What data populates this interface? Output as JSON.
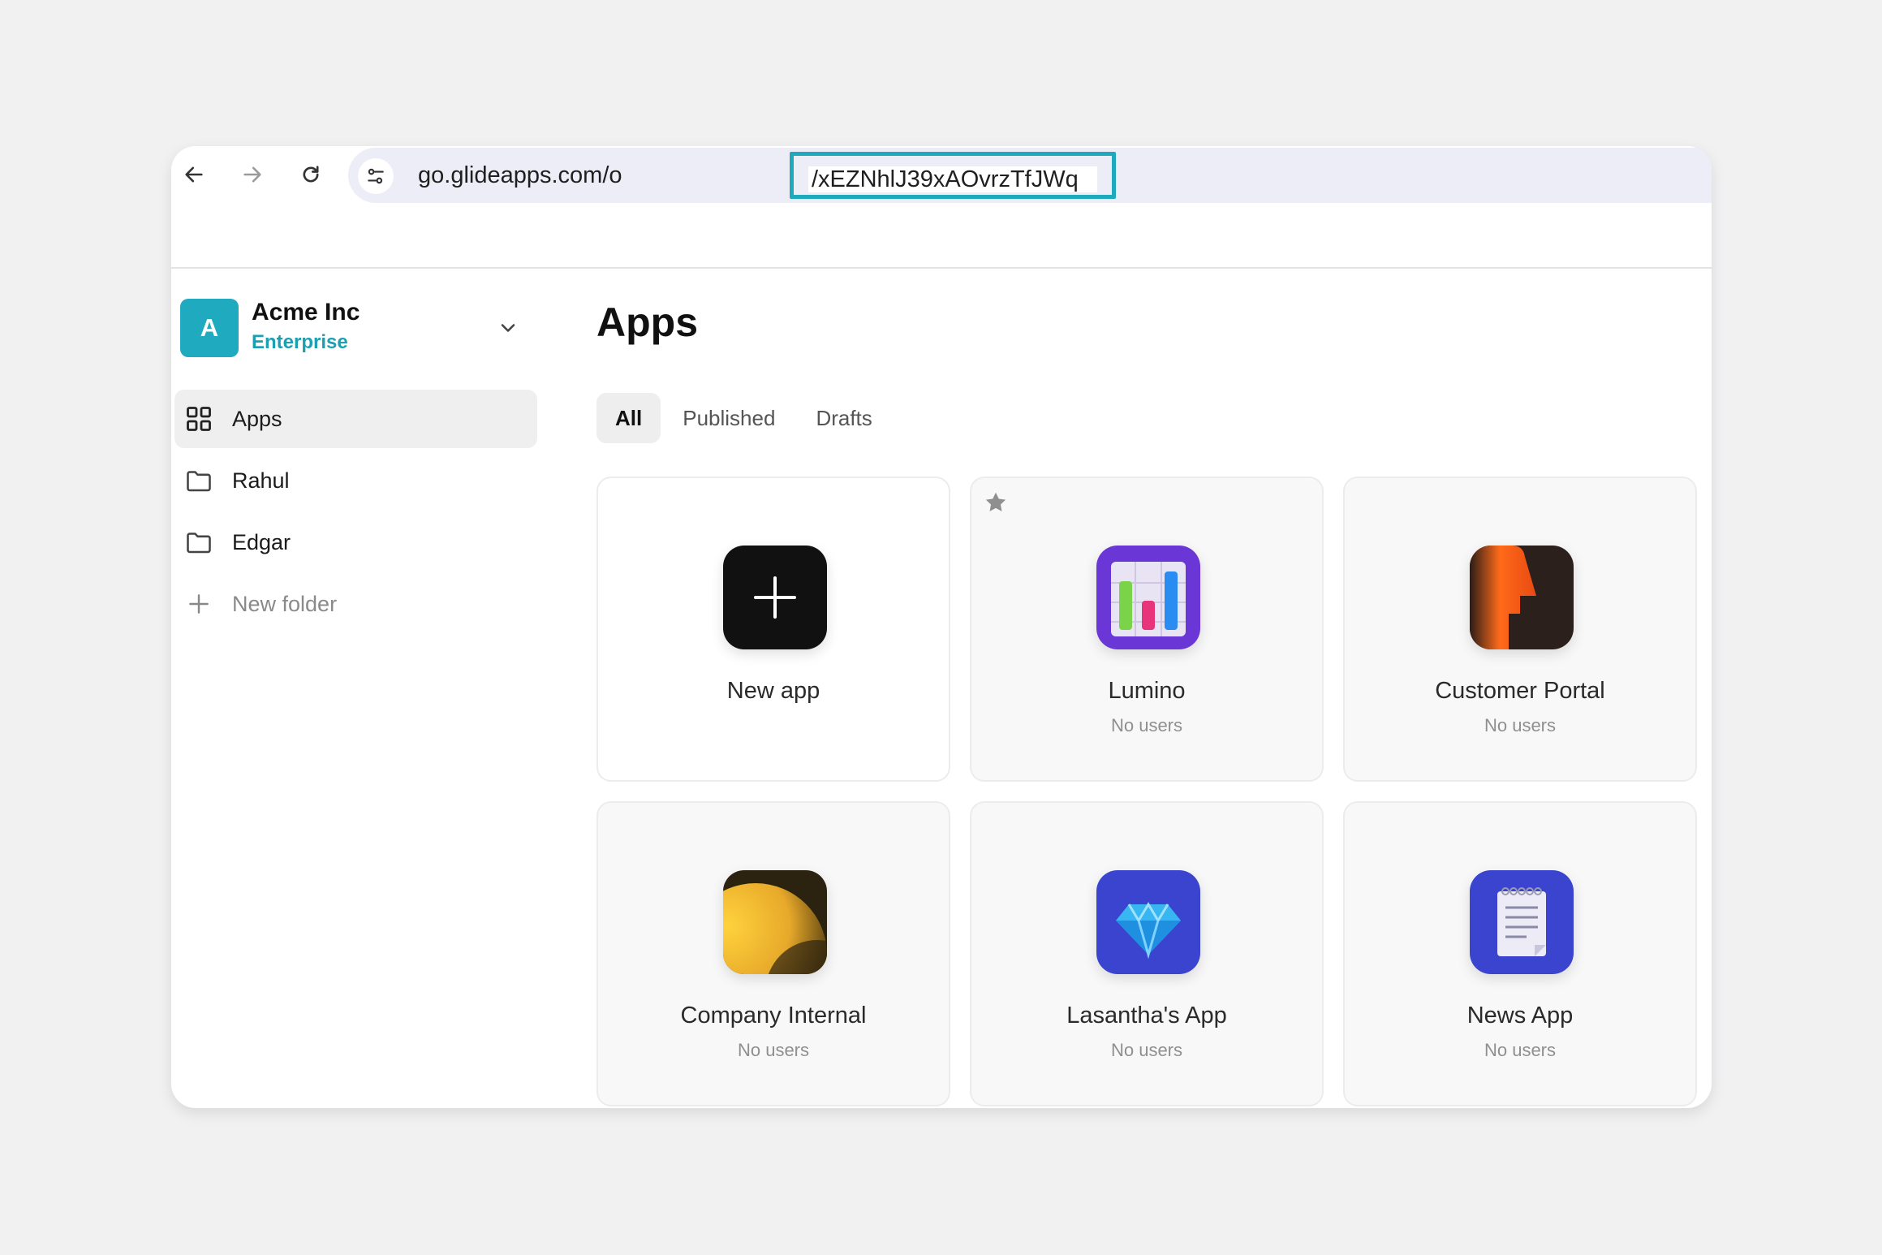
{
  "browser": {
    "url_host": "go.glideapps.com/o",
    "url_path": "/xEZNhlJ39xAOvrzTfJWq",
    "back_icon": "arrow-left-icon",
    "forward_icon": "arrow-right-icon",
    "reload_icon": "reload-icon",
    "site_info_icon": "tune-icon",
    "highlight_color": "#1ea9bd"
  },
  "sidebar": {
    "org": {
      "initial": "A",
      "name": "Acme Inc",
      "plan": "Enterprise",
      "color": "#20aabf"
    },
    "items": [
      {
        "label": "Apps",
        "icon": "grid-icon",
        "active": true
      },
      {
        "label": "Rahul",
        "icon": "folder-icon"
      },
      {
        "label": "Edgar",
        "icon": "folder-icon"
      },
      {
        "label": "New folder",
        "icon": "plus-icon"
      }
    ]
  },
  "main": {
    "title": "Apps",
    "tabs": [
      {
        "label": "All",
        "active": true
      },
      {
        "label": "Published"
      },
      {
        "label": "Drafts"
      }
    ],
    "apps": [
      {
        "title": "New app",
        "subtitle": ""
      },
      {
        "title": "Lumino",
        "subtitle": "No users",
        "starred": true
      },
      {
        "title": "Customer Portal",
        "subtitle": "No users"
      },
      {
        "title": "Company Internal",
        "subtitle": "No users"
      },
      {
        "title": "Lasantha's App",
        "subtitle": "No users"
      },
      {
        "title": "News App",
        "subtitle": "No users"
      }
    ]
  }
}
